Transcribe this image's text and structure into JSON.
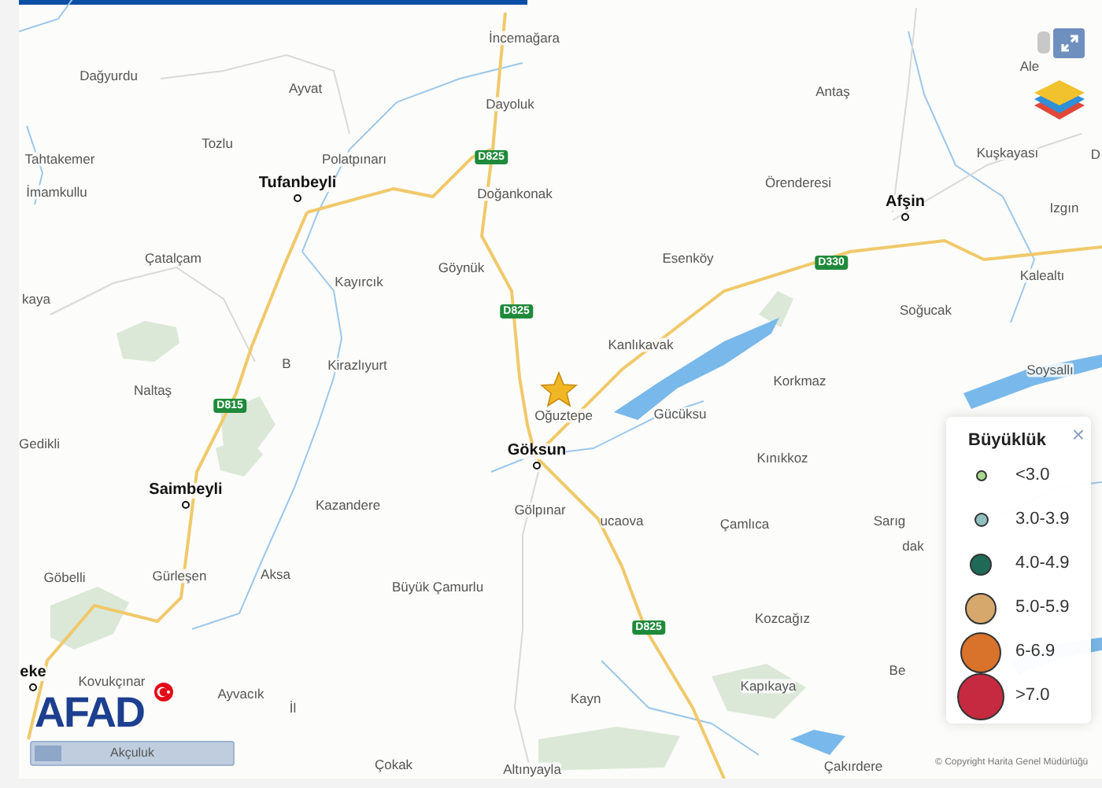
{
  "map": {
    "places": [
      {
        "text": "İncemağara",
        "kind": "village"
      },
      {
        "text": "Ale",
        "kind": "village"
      },
      {
        "text": "Dağyurdu",
        "kind": "village"
      },
      {
        "text": "Ayvat",
        "kind": "village"
      },
      {
        "text": "Antaş",
        "kind": "village"
      },
      {
        "text": "Dayoluk",
        "kind": "village"
      },
      {
        "text": "Tozlu",
        "kind": "village"
      },
      {
        "text": "Tahtakemer",
        "kind": "village"
      },
      {
        "text": "Polatpınarı",
        "kind": "village"
      },
      {
        "text": "Kuşkayası",
        "kind": "village"
      },
      {
        "text": "D",
        "kind": "village"
      },
      {
        "text": "İmamkullu",
        "kind": "village"
      },
      {
        "text": "Tufanbeyli",
        "kind": "district"
      },
      {
        "text": "Doğankonak",
        "kind": "village"
      },
      {
        "text": "Örenderesi",
        "kind": "village"
      },
      {
        "text": "Afşin",
        "kind": "district"
      },
      {
        "text": "Izgın",
        "kind": "village"
      },
      {
        "text": "Çatalçam",
        "kind": "village"
      },
      {
        "text": "Göynük",
        "kind": "village"
      },
      {
        "text": "Esenköy",
        "kind": "village"
      },
      {
        "text": "Kayırcık",
        "kind": "village"
      },
      {
        "text": "Kalealtı",
        "kind": "village"
      },
      {
        "text": "kaya",
        "kind": "village"
      },
      {
        "text": "Soğucak",
        "kind": "village"
      },
      {
        "text": "Kanlıkavak",
        "kind": "village"
      },
      {
        "text": "B",
        "kind": "village"
      },
      {
        "text": "Kirazlıyurt",
        "kind": "village"
      },
      {
        "text": "Naltaş",
        "kind": "village"
      },
      {
        "text": "Korkmaz",
        "kind": "village"
      },
      {
        "text": "Soysallı",
        "kind": "village"
      },
      {
        "text": "Oğuztepe",
        "kind": "village"
      },
      {
        "text": "Gücüksu",
        "kind": "village"
      },
      {
        "text": "Gedikli",
        "kind": "village"
      },
      {
        "text": "Göksun",
        "kind": "district"
      },
      {
        "text": "Kınıkkoz",
        "kind": "village"
      },
      {
        "text": "Saimbeyli",
        "kind": "district"
      },
      {
        "text": "Kazandere",
        "kind": "village"
      },
      {
        "text": "Gölpınar",
        "kind": "village"
      },
      {
        "text": "ucaova",
        "kind": "village"
      },
      {
        "text": "Çamlıca",
        "kind": "village"
      },
      {
        "text": "Sarıg",
        "kind": "village"
      },
      {
        "text": "dak",
        "kind": "village"
      },
      {
        "text": "Göbelli",
        "kind": "village"
      },
      {
        "text": "Gürleşen",
        "kind": "village"
      },
      {
        "text": "Aksa",
        "kind": "village"
      },
      {
        "text": "Büyük Çamurlu",
        "kind": "village"
      },
      {
        "text": "Kozcağız",
        "kind": "village"
      },
      {
        "text": "eke",
        "kind": "district"
      },
      {
        "text": "Kovukçınar",
        "kind": "village"
      },
      {
        "text": "Kapıkaya",
        "kind": "village"
      },
      {
        "text": "Be",
        "kind": "village"
      },
      {
        "text": "Ayvacık",
        "kind": "village"
      },
      {
        "text": "Kayn",
        "kind": "village"
      },
      {
        "text": "İl",
        "kind": "village"
      },
      {
        "text": "Çokak",
        "kind": "village"
      },
      {
        "text": "Altınyayla",
        "kind": "village"
      },
      {
        "text": "Çakırdere",
        "kind": "village"
      }
    ],
    "road_shields": [
      "D825",
      "D825",
      "D815",
      "D330",
      "D825"
    ],
    "copyright": "© Copyright Harita Genel Müdürlüğü"
  },
  "logo": {
    "text": "AFAD"
  },
  "bottom_bar": {
    "text": "Akçuluk"
  },
  "legend": {
    "title": "Büyüklük",
    "close": "×",
    "items": [
      {
        "label": "<3.0",
        "color": "#a9d98c"
      },
      {
        "label": "3.0-3.9",
        "color": "#8fbfbf"
      },
      {
        "label": "4.0-4.9",
        "color": "#1f6a57"
      },
      {
        "label": "5.0-5.9",
        "color": "#d6a86c"
      },
      {
        "label": "6-6.9",
        "color": "#d9722b"
      },
      {
        "label": ">7.0",
        "color": "#c62a40"
      }
    ]
  }
}
